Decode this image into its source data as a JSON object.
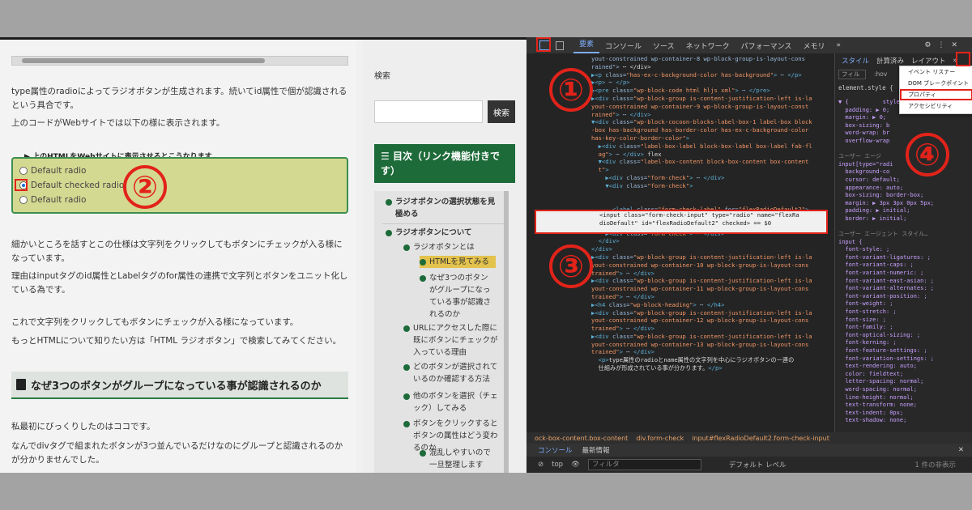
{
  "left": {
    "paragraphs": [
      "type属性のradioによってラジオボタンが生成されます。続いてid属性で個が認識されるという具合です。",
      "上のコードがWebサイトでは以下の様に表示されます。",
      "細かいところを話すとこの仕様は文字列をクリックしてもボタンにチェックが入る様になっています。",
      "理由はinputタグのid属性とLabelタグのfor属性の連携で文字列とボタンをユニット化している為です。",
      "これで文字列をクリックしてもボタンにチェックが入る様になっています。",
      "もっとHTMLについて知りたい方は「HTML ラジオボタン」で検索してみてください。",
      "私最初にびっくりしたのはココです。",
      "なんでdivタグで組まれたボタンが3つ並んでいるだけなのにグループと認識されるのかが分かりませんでした。"
    ],
    "demo_legend": "上のHTMLをWebサイトに表示させるとこうなります",
    "radios": [
      "Default radio",
      "Default checked radio",
      "Default radio"
    ],
    "heading": "なぜ3つのボタンがグループになっている事が認識されるのか"
  },
  "sidebar": {
    "search_label": "検索",
    "search_button": "検索",
    "toc_title": "目次（リンク機能付きです）",
    "toc_items": [
      "ラジオボタンの選択状態を見極める",
      "ラジオボタンについて",
      "ラジオボタンとは",
      "HTMLを見てみる",
      "なぜ3つのボタンがグループになっている事が認識されるのか",
      "URLにアクセスした際に既にボタンにチェックが入っている理由",
      "どのボタンが選択されているのか確認する方法",
      "他のボタンを選択（チェック）してみる",
      "ボタンをクリックするとボタンの属性はどう変わるのか",
      "混乱しやすいので一旦整理します"
    ]
  },
  "devtools": {
    "tabs": [
      "要素",
      "コンソール",
      "ソース",
      "ネットワーク",
      "パフォーマンス",
      "メモリ",
      "»"
    ],
    "styles_tabs": [
      "スタイル",
      "計算済み",
      "レイアウト",
      "»"
    ],
    "popup_items": [
      "イベント リスナー",
      "DOM ブレークポイント",
      "プロパティ",
      "アクセシビリティ"
    ],
    "filter_placeholder": "フィル",
    "hov": ":hov",
    "breadcrumbs": [
      "ock-box-content.box-content",
      "div.form-check",
      "input#flexRadioDefault2.form-check-input"
    ],
    "console_tabs": [
      "コンソール",
      "最新情報"
    ],
    "console_filter_placeholder": "フィルタ",
    "context": "top",
    "level": "デフォルト レベル",
    "hidden_count": "1 件の非表示",
    "element_style": "element.style {",
    "ua_label": "ユーザー エージェント スタイル",
    "selected_html_1": "<input class=\"form-check-input\" type=\"radio\" name=\"flexRa",
    "selected_html_2": "dioDefault\" id=\"flexRadioDefault2\" checked> == $0"
  },
  "markers": [
    "①",
    "②",
    "③",
    "④"
  ],
  "colors": {
    "accent_red": "#e2231a",
    "sidebar_green": "#1e6b3a",
    "devtools_bg": "#242424"
  }
}
